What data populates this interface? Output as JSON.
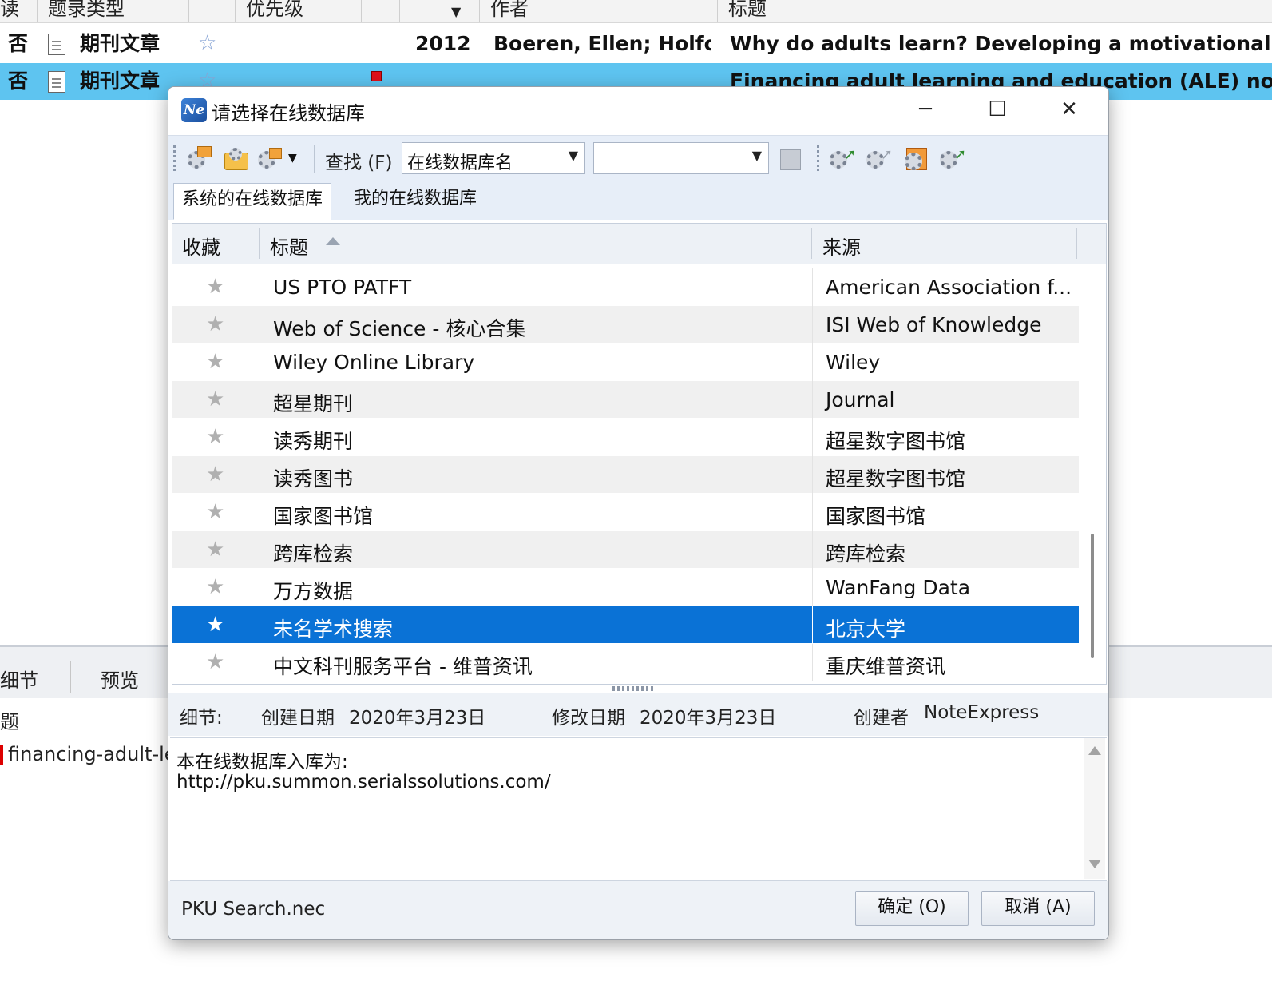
{
  "background": {
    "columns": [
      "读",
      "题录类型",
      "",
      "优先级",
      "",
      "",
      "作者",
      "标题"
    ],
    "rows": [
      {
        "read": "否",
        "type": "期刊文章",
        "year": "2012",
        "author": "Boeren, Ellen; Holfor",
        "title": "Why do adults learn? Developing a motivational t"
      },
      {
        "read": "否",
        "type": "期刊文章",
        "year": "",
        "author": "",
        "title": "Financing adult learning and education (ALE) now"
      }
    ],
    "bottom_tabs": [
      "细节",
      "预览"
    ],
    "bottom_label": "题",
    "bottom_file": "financing-adult-le"
  },
  "dialog": {
    "title": "请选择在线数据库",
    "app_icon": "NE",
    "toolbar": {
      "find_label": "查找 (F)",
      "field_select": "在线数据库名",
      "search_value": ""
    },
    "tabs": [
      "系统的在线数据库",
      "我的在线数据库"
    ],
    "columns": [
      "收藏",
      "标题",
      "来源"
    ],
    "rows": [
      {
        "title": "US PTO PATFT",
        "source": "American Association f..."
      },
      {
        "title": "Web of Science - 核心合集",
        "source": "ISI Web of Knowledge"
      },
      {
        "title": "Wiley Online Library",
        "source": "Wiley"
      },
      {
        "title": "超星期刊",
        "source": "Journal"
      },
      {
        "title": "读秀期刊",
        "source": "超星数字图书馆"
      },
      {
        "title": "读秀图书",
        "source": "超星数字图书馆"
      },
      {
        "title": "国家图书馆",
        "source": "国家图书馆"
      },
      {
        "title": "跨库检索",
        "source": "跨库检索"
      },
      {
        "title": "万方数据",
        "source": "WanFang Data"
      },
      {
        "title": "未名学术搜索",
        "source": "北京大学"
      },
      {
        "title": "中文科刊服务平台 - 维普资讯",
        "source": "重庆维普资讯"
      }
    ],
    "selected_row": 9,
    "details": {
      "label": "细节:",
      "created_label": "创建日期",
      "created": "2020年3月23日",
      "modified_label": "修改日期",
      "modified": "2020年3月23日",
      "creator_label": "创建者",
      "creator": "NoteExpress"
    },
    "description": [
      "本在线数据库入库为:",
      "http://pku.summon.serialssolutions.com/"
    ],
    "footer": {
      "file": "PKU Search.nec",
      "ok": "确定 (O)",
      "cancel": "取消 (A)"
    },
    "colors": {
      "selection": "#0a72d6",
      "row_highlight": "#5ec4f0"
    }
  }
}
